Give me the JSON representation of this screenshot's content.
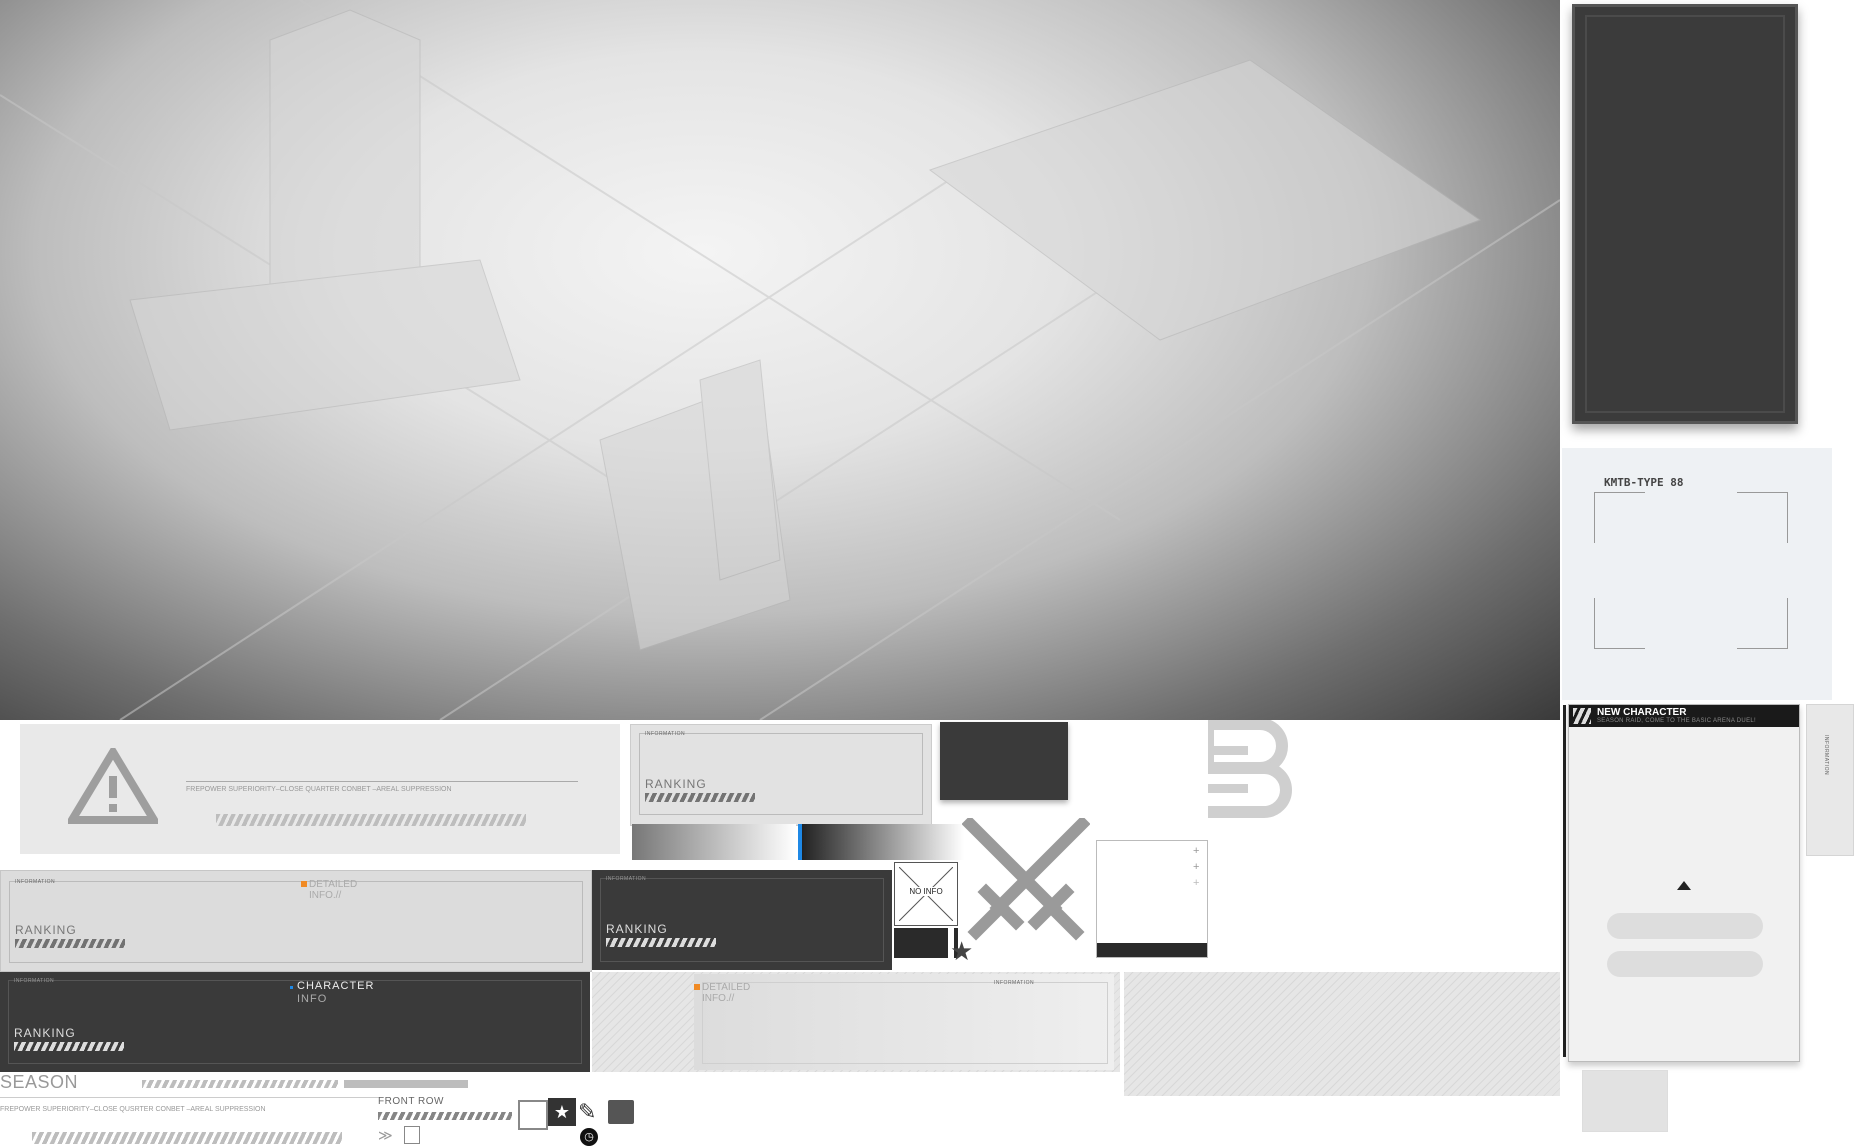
{
  "map_preview": {
    "icon": "city-scene"
  },
  "warning_banner": {
    "subtitle": "FREPOWER SUPERIORITY–CLOSE QUARTER CONBET –AREAL SUPPRESSION",
    "icon": "warning-triangle-icon"
  },
  "ranking_cards": [
    {
      "label": "RANKING",
      "header": "INFORMATION",
      "theme": "light"
    },
    {
      "label": "RANKING",
      "header": "INFORMATION",
      "theme": "light"
    },
    {
      "label": "RANKING",
      "header": "INFORMATION",
      "theme": "dark"
    },
    {
      "label": "RANKING",
      "header": "INFORMATION",
      "theme": "dark"
    }
  ],
  "detailed_info": {
    "line1": "DETAILED",
    "line2": "INFO.//"
  },
  "detailed_info_2": {
    "line1": "DETAILED",
    "line2": "INFO.//",
    "header": "INFORMATION"
  },
  "character_info": {
    "line1": "CHARACTER",
    "line2": "INFO"
  },
  "no_info": {
    "label": "NO INFO"
  },
  "season": {
    "title": "SEASON",
    "subtitle": "FREPOWER SUPERIORITY–CLOSE QUSRTER CONBET –AREAL SUPPRESSION"
  },
  "front_row": {
    "label": "FRONT ROW"
  },
  "frame_panel": {
    "label": "KMTB-TYPE 88"
  },
  "new_character": {
    "title": "NEW CHARACTER",
    "subtitle": "SEASON RAID, COME TO THE BASIC ARENA DUEL!",
    "side_label": "INFORMATION"
  },
  "colors": {
    "accent_blue": "#1e88e5",
    "accent_orange": "#f08a24",
    "dark_panel": "#3a3a3a"
  }
}
